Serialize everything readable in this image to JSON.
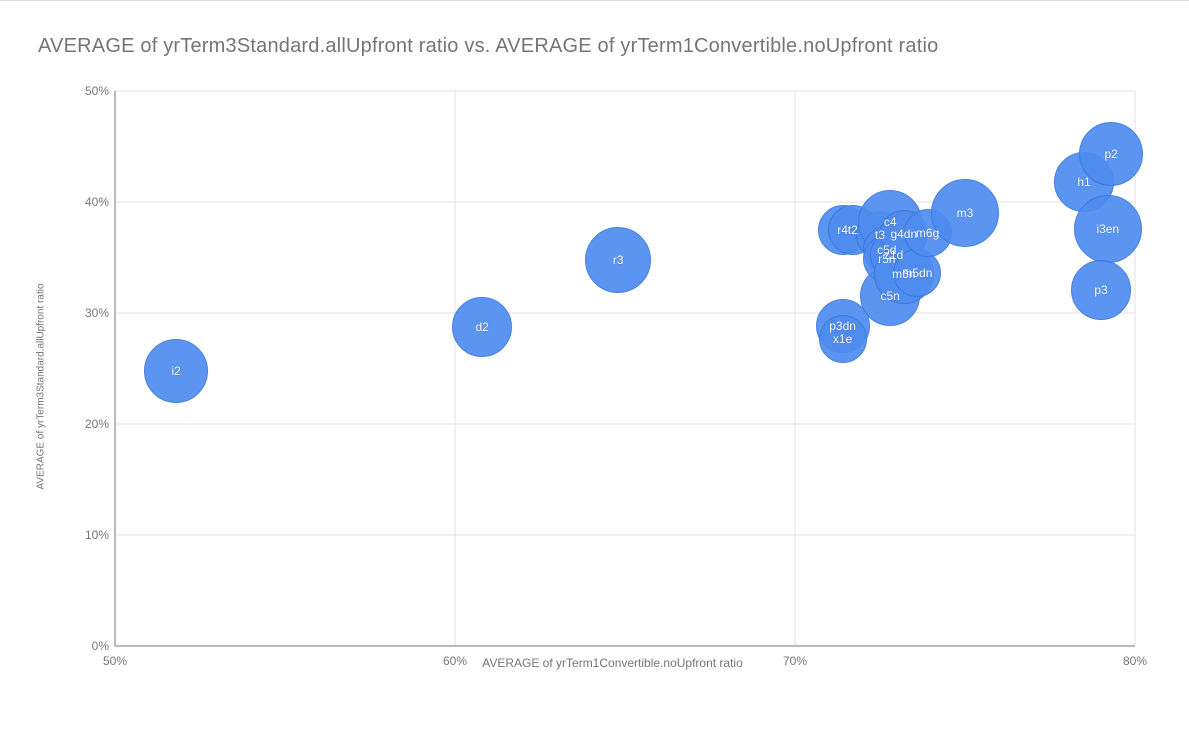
{
  "chart_data": {
    "type": "scatter",
    "title": "AVERAGE of yrTerm3Standard.allUpfront ratio vs. AVERAGE of yrTerm1Convertible.noUpfront ratio",
    "xlabel": "AVERAGE of yrTerm1Convertible.noUpfront ratio",
    "ylabel": "AVERAGE of yrTerm3Standard.allUpfront ratio",
    "xlim": [
      50,
      80
    ],
    "ylim": [
      0,
      50
    ],
    "x_ticks": [
      "50%",
      "60%",
      "70%",
      "80%"
    ],
    "y_ticks": [
      "0%",
      "10%",
      "20%",
      "30%",
      "40%",
      "50%"
    ],
    "points": [
      {
        "name": "i2",
        "x": 51.8,
        "y": 24.8,
        "size": 32
      },
      {
        "name": "d2",
        "x": 60.8,
        "y": 28.7,
        "size": 30
      },
      {
        "name": "r3",
        "x": 64.8,
        "y": 34.8,
        "size": 33
      },
      {
        "name": "p3dn",
        "x": 71.4,
        "y": 28.8,
        "size": 27
      },
      {
        "name": "x1e",
        "x": 71.4,
        "y": 27.7,
        "size": 24
      },
      {
        "name": "r4",
        "x": 71.4,
        "y": 37.5,
        "size": 25
      },
      {
        "name": "t2",
        "x": 71.7,
        "y": 37.5,
        "size": 25
      },
      {
        "name": "c5n",
        "x": 72.8,
        "y": 31.5,
        "size": 30
      },
      {
        "name": "t3",
        "x": 72.5,
        "y": 37.0,
        "size": 24
      },
      {
        "name": "c4",
        "x": 72.8,
        "y": 38.2,
        "size": 32
      },
      {
        "name": "c5d",
        "x": 72.7,
        "y": 35.7,
        "size": 24
      },
      {
        "name": "r5n",
        "x": 72.7,
        "y": 34.9,
        "size": 24
      },
      {
        "name": "z1d",
        "x": 72.9,
        "y": 35.2,
        "size": 24
      },
      {
        "name": "m5n",
        "x": 73.2,
        "y": 33.5,
        "size": 30
      },
      {
        "name": "g4dn",
        "x": 73.2,
        "y": 37.1,
        "size": 24
      },
      {
        "name": "m5dn",
        "x": 73.6,
        "y": 33.6,
        "size": 24
      },
      {
        "name": "m6g",
        "x": 73.9,
        "y": 37.2,
        "size": 24
      },
      {
        "name": "m3",
        "x": 75.0,
        "y": 39.0,
        "size": 34
      },
      {
        "name": "h1",
        "x": 78.5,
        "y": 41.8,
        "size": 30
      },
      {
        "name": "p2",
        "x": 79.3,
        "y": 44.3,
        "size": 32
      },
      {
        "name": "i3en",
        "x": 79.2,
        "y": 37.6,
        "size": 34
      },
      {
        "name": "p3",
        "x": 79.0,
        "y": 32.1,
        "size": 30
      }
    ]
  }
}
